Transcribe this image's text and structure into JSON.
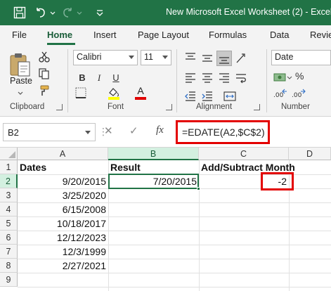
{
  "window": {
    "title": "New Microsoft Excel Worksheet (2) - Excel"
  },
  "quick_access": {
    "save_icon": "save-icon",
    "undo_icon": "undo-icon",
    "redo_icon": "redo-icon",
    "customize_icon": "chevron-down-icon"
  },
  "tabs": [
    {
      "label": "File"
    },
    {
      "label": "Home",
      "active": true
    },
    {
      "label": "Insert"
    },
    {
      "label": "Page Layout"
    },
    {
      "label": "Formulas"
    },
    {
      "label": "Data"
    },
    {
      "label": "Review"
    }
  ],
  "ribbon": {
    "clipboard": {
      "label": "Clipboard",
      "paste_label": "Paste"
    },
    "font": {
      "label": "Font",
      "font_name": "Calibri",
      "font_size": "11",
      "bold_label": "B",
      "italic_label": "I",
      "underline_label": "U",
      "font_color_label": "A"
    },
    "alignment": {
      "label": "Alignment"
    },
    "number": {
      "label": "Number",
      "format": "Date"
    }
  },
  "formula_bar": {
    "name_box": "B2",
    "cancel_label": "✕",
    "enter_label": "✓",
    "fx_label": "fx",
    "formula": "=EDATE(A2,$C$2)"
  },
  "sheet": {
    "columns": [
      "A",
      "B",
      "C",
      "D"
    ],
    "rows": [
      "1",
      "2",
      "3",
      "4",
      "5",
      "6",
      "7",
      "8",
      "9"
    ],
    "headers": {
      "A1": "Dates",
      "B1": "Result",
      "C1": "Add/Subtract Month"
    },
    "dates": [
      "9/20/2015",
      "3/25/2020",
      "6/15/2008",
      "10/18/2017",
      "12/12/2023",
      "12/3/1999",
      "2/27/2021"
    ],
    "B2": "7/20/2015",
    "C2": "-2",
    "active_cell": "B2"
  },
  "colors": {
    "title_bar": "#217346",
    "accent": "#185c37",
    "highlight_box": "#e30000"
  }
}
